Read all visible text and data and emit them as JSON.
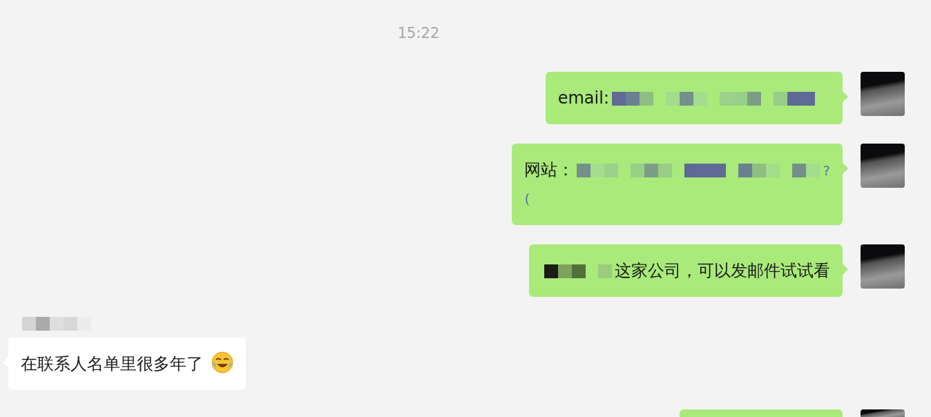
{
  "timestamp": "15:22",
  "messages": [
    {
      "outgoing": true,
      "segments": [
        {
          "kind": "text",
          "text": "email:"
        },
        {
          "kind": "redacted"
        }
      ]
    },
    {
      "outgoing": true,
      "segments": [
        {
          "kind": "text",
          "text": "网站："
        },
        {
          "kind": "redacted"
        },
        {
          "kind": "link",
          "text": "?"
        },
        {
          "kind": "break"
        },
        {
          "kind": "link",
          "text": "("
        }
      ]
    },
    {
      "outgoing": true,
      "segments": [
        {
          "kind": "redacted"
        },
        {
          "kind": "text",
          "text": "这家公司，可以发邮件试试看"
        }
      ]
    },
    {
      "outgoing": false,
      "sender": {
        "kind": "redacted"
      },
      "segments": [
        {
          "kind": "text",
          "text": "在联系人名单里很多年了"
        },
        {
          "kind": "emoji"
        }
      ]
    },
    {
      "outgoing": true,
      "cut_off": true
    }
  ]
}
